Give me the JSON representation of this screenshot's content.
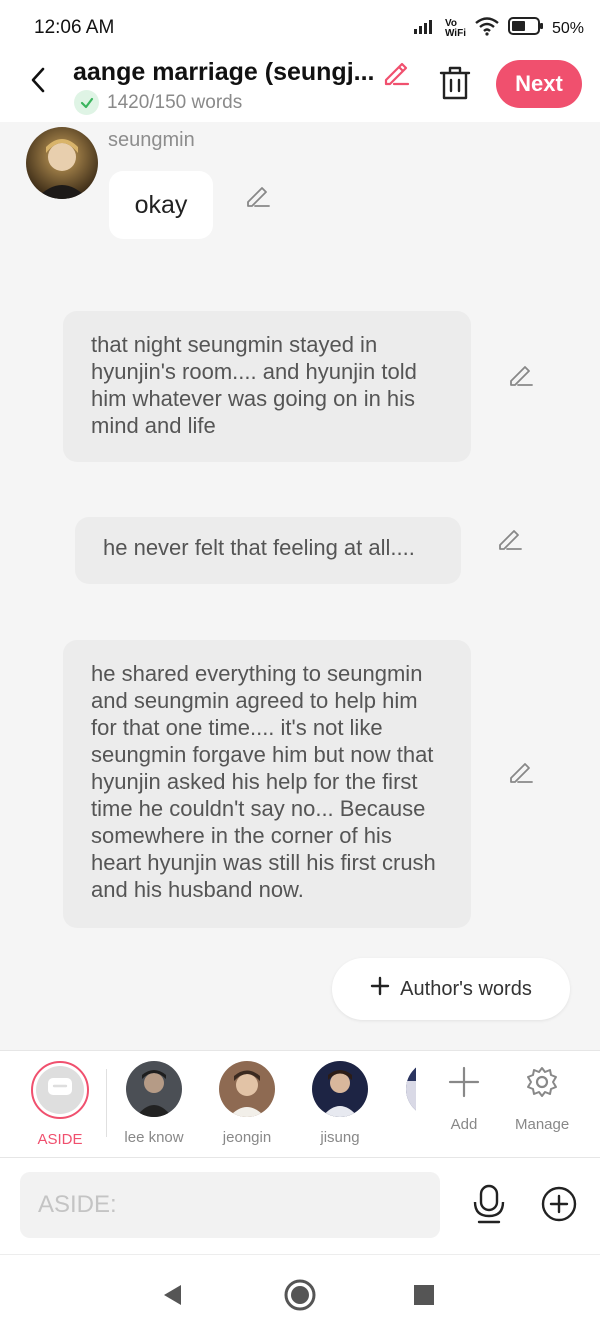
{
  "status_bar": {
    "time": "12:06 AM",
    "volte": "Vo\nWiFi",
    "battery_percent": "50%"
  },
  "header": {
    "title": "aange marriage (seungj...",
    "word_count": "1420/150 words",
    "next_label": "Next",
    "accent_color": "#f0506e"
  },
  "chat": {
    "speaker_name": "seungmin",
    "speaker_message": "okay",
    "asides": [
      "that night seungmin stayed in hyunjin's room.... and hyunjin told him whatever was going on in his mind and life",
      "he never felt that feeling at all....",
      "he shared everything to seungmin and seungmin agreed to help him for that one time.... it's not like seungmin forgave him but now that hyunjin asked his help for the first time he couldn't say no... Because somewhere in the corner of his heart hyunjin was still his first crush and his husband now."
    ],
    "author_words_label": "Author's words"
  },
  "characters": {
    "items": [
      {
        "label": "ASIDE",
        "active": true
      },
      {
        "label": "lee know"
      },
      {
        "label": "jeongin"
      },
      {
        "label": "jisung"
      }
    ],
    "add_label": "Add",
    "manage_label": "Manage"
  },
  "input": {
    "placeholder": "ASIDE:"
  }
}
